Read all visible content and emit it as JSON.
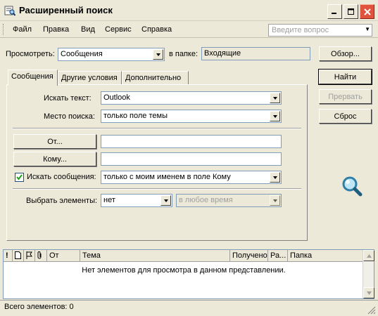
{
  "window": {
    "title": "Расширенный поиск"
  },
  "menubar": {
    "items": [
      "Файл",
      "Правка",
      "Вид",
      "Сервис",
      "Справка"
    ],
    "ask_placeholder": "Введите вопрос"
  },
  "top": {
    "look_for_label": "Просмотреть:",
    "look_for_value": "Сообщения",
    "in_folder_label": "в папке:",
    "in_folder_value": "Входящие",
    "browse_button": "Обзор..."
  },
  "actions": {
    "find_button": "Найти",
    "stop_button": "Прервать",
    "reset_button": "Сброс"
  },
  "tabs": [
    "Сообщения",
    "Другие условия",
    "Дополнительно"
  ],
  "messages_tab": {
    "search_text_label": "Искать текст:",
    "search_text_value": "Outlook",
    "search_in_label": "Место поиска:",
    "search_in_value": "только поле темы",
    "from_button": "От...",
    "from_value": "",
    "to_button": "Кому...",
    "to_value": "",
    "where_checkbox_label": "Искать сообщения:",
    "where_checkbox_checked": true,
    "where_value": "только с моим именем в поле Кому",
    "time_label": "Выбрать элементы:",
    "time_field_value": "нет",
    "time_range_value": "в любое время"
  },
  "results": {
    "columns": [
      "!",
      "",
      "",
      "",
      "От",
      "Тема",
      "Получено",
      "Ра...",
      "Папка"
    ],
    "empty_message": "Нет элементов для просмотра в данном представлении."
  },
  "status": {
    "text": "Всего элементов: 0"
  }
}
